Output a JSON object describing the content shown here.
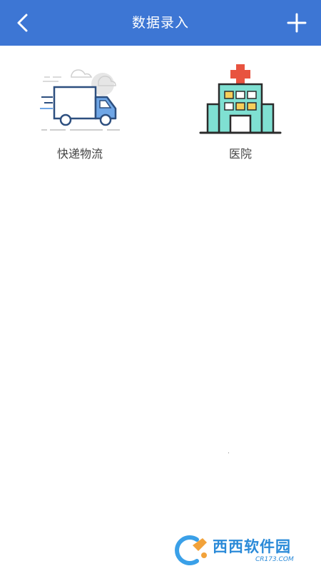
{
  "header": {
    "title": "数据录入",
    "back_icon": "chevron-left-icon",
    "add_icon": "plus-icon"
  },
  "categories": [
    {
      "label": "快递物流",
      "icon": "delivery-truck-icon"
    },
    {
      "label": "医院",
      "icon": "hospital-icon"
    }
  ],
  "watermark": {
    "brand": "西西软件园",
    "domain": "CR173.COM"
  },
  "colors": {
    "header_bg": "#3d76d4",
    "header_fg": "#ffffff",
    "truck_blue": "#6fa6e6",
    "truck_outline": "#2d4f7f",
    "hospital_teal": "#7fe0d2",
    "hospital_cross": "#e8533f",
    "hospital_window": "#f7cf5a"
  }
}
